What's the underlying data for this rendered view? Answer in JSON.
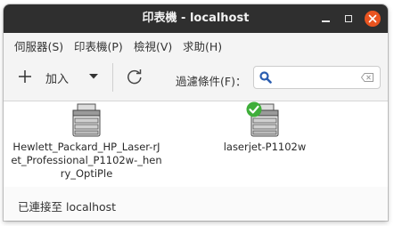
{
  "window": {
    "title": "印表機 - localhost"
  },
  "menubar": {
    "items": [
      {
        "label": "伺服器(S)"
      },
      {
        "label": "印表機(P)"
      },
      {
        "label": "檢視(V)"
      },
      {
        "label": "求助(H)"
      }
    ]
  },
  "toolbar": {
    "add_label": "加入",
    "filter_label": "過濾條件(F)：",
    "search_value": ""
  },
  "printers": [
    {
      "name": "Hewlett_Packard_HP_Laser-rJet_Professional_P1102w-_henry_OptiPle",
      "is_default": false
    },
    {
      "name": "laserjet-P1102w",
      "is_default": true
    }
  ],
  "status": {
    "text": "已連接至 localhost"
  },
  "colors": {
    "titlebar": "#2f2f2f",
    "close_button": "#e95420",
    "default_badge": "#3fae3a",
    "search_icon": "#2a5db0"
  }
}
